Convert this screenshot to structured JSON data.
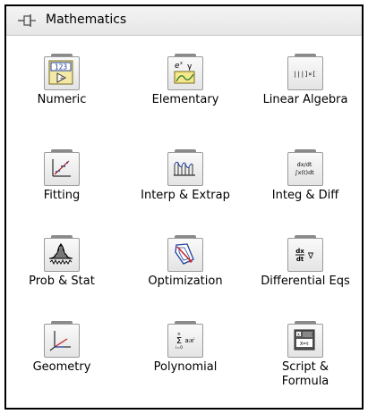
{
  "palette": {
    "title": "Mathematics",
    "items": [
      {
        "label": "Numeric",
        "icon": "numeric-icon"
      },
      {
        "label": "Elementary",
        "icon": "elementary-icon"
      },
      {
        "label": "Linear Algebra",
        "icon": "linear-algebra-icon"
      },
      {
        "label": "Fitting",
        "icon": "fitting-icon"
      },
      {
        "label": "Interp & Extrap",
        "icon": "interp-extrap-icon"
      },
      {
        "label": "Integ & Diff",
        "icon": "integ-diff-icon"
      },
      {
        "label": "Prob & Stat",
        "icon": "prob-stat-icon"
      },
      {
        "label": "Optimization",
        "icon": "optimization-icon"
      },
      {
        "label": "Differential Eqs",
        "icon": "differential-eqs-icon"
      },
      {
        "label": "Geometry",
        "icon": "geometry-icon"
      },
      {
        "label": "Polynomial",
        "icon": "polynomial-icon"
      },
      {
        "label": "Script & Formula",
        "icon": "script-formula-icon"
      }
    ]
  },
  "icon_text": {
    "numeric": "123",
    "elementary": "e",
    "elementary_sup": "x",
    "elementary_gamma": "γ",
    "linear_algebra": "[|||]×[]",
    "integ_top": "dx/dt",
    "integ_bottom": "∫x(t)dt",
    "diffeq_num": "dx",
    "diffeq_den": "dt",
    "diffeq_nabla": "∇",
    "poly_sigma": "Σ",
    "poly_n": "n",
    "poly_i": "i=0",
    "poly_term": "aᵢxⁱ",
    "script_top": "x",
    "script_bottom": "X=t"
  },
  "colors": {
    "titlebar_top": "#f4f4f4",
    "titlebar_bottom": "#e6e6e6",
    "border": "#000000"
  }
}
